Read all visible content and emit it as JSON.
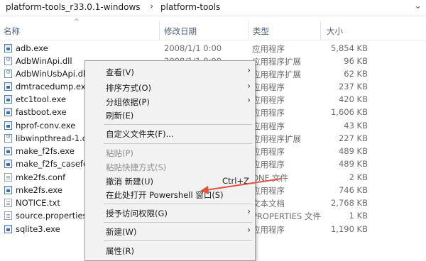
{
  "breadcrumb": {
    "items": [
      "platform-tools_r33.0.1-windows",
      "platform-tools"
    ],
    "separator": "›"
  },
  "columns": {
    "name": "名称",
    "date": "修改日期",
    "type": "类型",
    "size": "大小"
  },
  "files": [
    {
      "name": "adb.exe",
      "date": "2008/1/1 0:00",
      "type": "应用程序",
      "size": "5,854 KB",
      "icon": "exe"
    },
    {
      "name": "AdbWinApi.dll",
      "date": "2008/1/1 0:00",
      "type": "应用程序扩展",
      "size": "96 KB",
      "icon": "dll"
    },
    {
      "name": "AdbWinUsbApi.dll",
      "date": "",
      "type": "应用程序扩展",
      "size": "62 KB",
      "icon": "dll"
    },
    {
      "name": "dmtracedump.exe",
      "date": "",
      "type": "应用程序",
      "size": "237 KB",
      "icon": "exe"
    },
    {
      "name": "etc1tool.exe",
      "date": "",
      "type": "应用程序",
      "size": "420 KB",
      "icon": "exe"
    },
    {
      "name": "fastboot.exe",
      "date": "",
      "type": "应用程序",
      "size": "1,606 KB",
      "icon": "exe"
    },
    {
      "name": "hprof-conv.exe",
      "date": "",
      "type": "应用程序",
      "size": "43 KB",
      "icon": "exe"
    },
    {
      "name": "libwinpthread-1.dll",
      "date": "",
      "type": "应用程序扩展",
      "size": "227 KB",
      "icon": "dll"
    },
    {
      "name": "make_f2fs.exe",
      "date": "",
      "type": "应用程序",
      "size": "489 KB",
      "icon": "exe"
    },
    {
      "name": "make_f2fs_casefold",
      "date": "",
      "type": "应用程序",
      "size": "489 KB",
      "icon": "exe"
    },
    {
      "name": "mke2fs.conf",
      "date": "",
      "type": "ONF 文件",
      "size": "2 KB",
      "icon": "txt"
    },
    {
      "name": "mke2fs.exe",
      "date": "",
      "type": "应用程序",
      "size": "746 KB",
      "icon": "exe"
    },
    {
      "name": "NOTICE.txt",
      "date": "",
      "type": "文本文档",
      "size": "2,768 KB",
      "icon": "txt"
    },
    {
      "name": "source.properties",
      "date": "",
      "type": "PROPERTIES 文件",
      "size": "1 KB",
      "icon": "txt"
    },
    {
      "name": "sqlite3.exe",
      "date": "",
      "type": "应用程序",
      "size": "1,190 KB",
      "icon": "exe"
    }
  ],
  "context_menu": {
    "items": [
      {
        "label": "查看(V)",
        "submenu": true
      },
      {
        "label": "排序方式(O)",
        "submenu": true
      },
      {
        "label": "分组依据(P)",
        "submenu": true
      },
      {
        "label": "刷新(E)"
      },
      {
        "label": "自定义文件夹(F)..."
      },
      {
        "label": "粘贴(P)",
        "disabled": true
      },
      {
        "label": "粘贴快捷方式(S)",
        "disabled": true
      },
      {
        "label": "撤消 新建(U)",
        "shortcut": "Ctrl+Z"
      },
      {
        "label": "在此处打开 Powershell 窗口(S)"
      },
      {
        "label": "授予访问权限(G)",
        "submenu": true
      },
      {
        "label": "新建(W)",
        "submenu": true
      },
      {
        "label": "属性(R)"
      }
    ]
  },
  "colors": {
    "annotation_arrow": "#e0533f",
    "header_text": "#4c607a"
  }
}
